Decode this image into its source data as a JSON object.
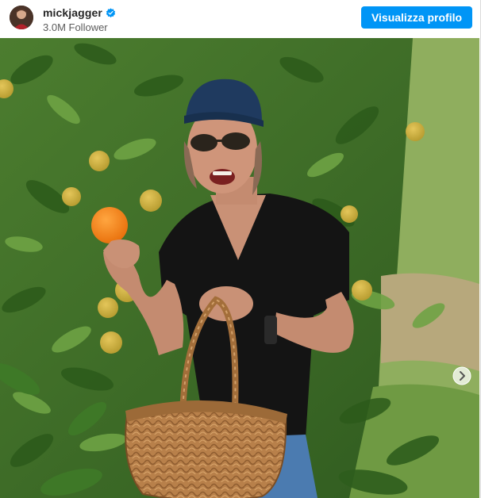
{
  "post_header": {
    "username": "mickjagger",
    "verified": true,
    "verified_icon": "verified-badge-icon",
    "followers": "3.0M Follower",
    "view_profile_label": "Visualizza profilo"
  },
  "colors": {
    "button_bg": "#0095f6",
    "verified_badge": "#0095f6",
    "username_text": "#262626",
    "subtle_text": "#5c5c5c"
  },
  "media": {
    "carousel_icon": "chevron-right-icon"
  }
}
